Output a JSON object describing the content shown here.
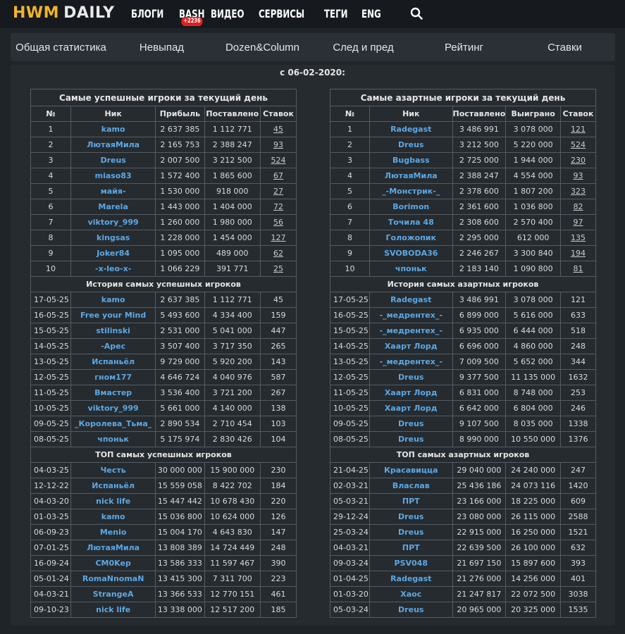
{
  "logo": {
    "part1": "HWM",
    "part2": "DAILY"
  },
  "nav": {
    "items": [
      "БЛОГИ",
      "BASH",
      "ВИДЕО",
      "СЕРВИСЫ",
      "ТЕГИ",
      "ENG"
    ],
    "bash_badge": "+2236"
  },
  "tabs": [
    "Общая статистика",
    "Невыпад",
    "Dozen&Column",
    "След и пред",
    "Рейтинг",
    "Ставки"
  ],
  "since": "с 06-02-2020:",
  "left": {
    "caption": "Самые успешные игроки за текущий день",
    "headers": [
      "№",
      "Ник",
      "Прибыль",
      "Поставлено",
      "Ставок"
    ],
    "daily": [
      [
        "1",
        "kamo",
        "2 637 385",
        "1 112 771",
        "45"
      ],
      [
        "2",
        "ЛютаяМила",
        "2 165 753",
        "2 388 247",
        "93"
      ],
      [
        "3",
        "Dreus",
        "2 007 500",
        "3 212 500",
        "524"
      ],
      [
        "4",
        "miaso83",
        "1 572 400",
        "1 865 600",
        "67"
      ],
      [
        "5",
        "майя-",
        "1 530 000",
        "918 000",
        "27"
      ],
      [
        "6",
        "Marela",
        "1 443 000",
        "1 404 000",
        "72"
      ],
      [
        "7",
        "viktory_999",
        "1 260 000",
        "1 980 000",
        "56"
      ],
      [
        "8",
        "kingsas",
        "1 228 000",
        "1 454 000",
        "127"
      ],
      [
        "9",
        "Joker84",
        "1 095 000",
        "489 000",
        "62"
      ],
      [
        "10",
        "-x-leo-x-",
        "1 066 229",
        "391 771",
        "25"
      ]
    ],
    "history_title": "История самых успешных игроков",
    "history": [
      [
        "17-05-25",
        "kamo",
        "2 637 385",
        "1 112 771",
        "45"
      ],
      [
        "16-05-25",
        "Free your Mind",
        "5 493 600",
        "4 334 400",
        "159"
      ],
      [
        "15-05-25",
        "stilinski",
        "2 531 000",
        "5 041 000",
        "447"
      ],
      [
        "14-05-25",
        "-Apec",
        "3 507 400",
        "3 717 350",
        "265"
      ],
      [
        "13-05-25",
        "Испаньёл",
        "9 729 000",
        "5 920 200",
        "143"
      ],
      [
        "12-05-25",
        "гном177",
        "4 646 724",
        "4 040 976",
        "587"
      ],
      [
        "11-05-25",
        "Вмастер",
        "3 536 400",
        "3 721 200",
        "267"
      ],
      [
        "10-05-25",
        "viktory_999",
        "5 661 000",
        "4 140 000",
        "138"
      ],
      [
        "09-05-25",
        "_Королева_Тьма_",
        "2 890 534",
        "2 710 454",
        "103"
      ],
      [
        "08-05-25",
        "чпоньк",
        "5 175 974",
        "2 830 426",
        "104"
      ]
    ],
    "top_title": "ТОП самых успешных игроков",
    "top": [
      [
        "04-03-25",
        "Честь",
        "30 000 000",
        "15 900 000",
        "230"
      ],
      [
        "12-12-22",
        "Испаньёл",
        "15 559 058",
        "8 422 702",
        "184"
      ],
      [
        "04-03-20",
        "nick life",
        "15 447 442",
        "10 678 430",
        "220"
      ],
      [
        "01-03-25",
        "kamo",
        "15 036 800",
        "10 624 000",
        "126"
      ],
      [
        "06-09-23",
        "Menio",
        "15 004 170",
        "4 643 830",
        "147"
      ],
      [
        "07-01-25",
        "ЛютаяМила",
        "13 808 389",
        "14 724 449",
        "248"
      ],
      [
        "16-09-24",
        "CM0Kep",
        "13 586 333",
        "11 597 467",
        "390"
      ],
      [
        "05-01-24",
        "RomaNnomaN",
        "13 415 300",
        "7 311 700",
        "223"
      ],
      [
        "04-03-21",
        "StrangeA",
        "13 366 533",
        "12 770 151",
        "461"
      ],
      [
        "09-10-23",
        "nick life",
        "13 338 000",
        "12 517 200",
        "185"
      ]
    ]
  },
  "right": {
    "caption": "Самые азартные игроки за текущий день",
    "headers": [
      "№",
      "Ник",
      "Поставлено",
      "Выиграно",
      "Ставок"
    ],
    "daily": [
      [
        "1",
        "Radegast",
        "3 486 991",
        "3 078 000",
        "121"
      ],
      [
        "2",
        "Dreus",
        "3 212 500",
        "5 220 000",
        "524"
      ],
      [
        "3",
        "Bugbass",
        "2 725 000",
        "1 944 000",
        "230"
      ],
      [
        "4",
        "ЛютаяМила",
        "2 388 247",
        "4 554 000",
        "93"
      ],
      [
        "5",
        "_-Монстрик-_",
        "2 378 600",
        "1 807 200",
        "323"
      ],
      [
        "6",
        "Borimon",
        "2 361 600",
        "1 036 800",
        "82"
      ],
      [
        "7",
        "Точила 48",
        "2 308 600",
        "2 570 400",
        "97"
      ],
      [
        "8",
        "Голожопик",
        "2 295 000",
        "612 000",
        "135"
      ],
      [
        "9",
        "SVOBODA36",
        "2 246 267",
        "3 300 840",
        "194"
      ],
      [
        "10",
        "чпоньк",
        "2 183 140",
        "1 090 800",
        "81"
      ]
    ],
    "history_title": "История самых азартных игроков",
    "history": [
      [
        "17-05-25",
        "Radegast",
        "3 486 991",
        "3 078 000",
        "121"
      ],
      [
        "16-05-25",
        "-_медрентех_-",
        "6 899 000",
        "5 616 000",
        "633"
      ],
      [
        "15-05-25",
        "-_медрентех_-",
        "6 935 000",
        "6 444 000",
        "518"
      ],
      [
        "14-05-25",
        "Хаарт Лорд",
        "6 696 000",
        "4 860 000",
        "248"
      ],
      [
        "13-05-25",
        "-_медрентех_-",
        "7 009 500",
        "5 652 000",
        "344"
      ],
      [
        "12-05-25",
        "Dreus",
        "9 377 500",
        "11 135 000",
        "1632"
      ],
      [
        "11-05-25",
        "Хаарт Лорд",
        "6 831 000",
        "8 748 000",
        "253"
      ],
      [
        "10-05-25",
        "Хаарт Лорд",
        "6 642 000",
        "6 804 000",
        "246"
      ],
      [
        "09-05-25",
        "Dreus",
        "9 107 500",
        "8 035 000",
        "1338"
      ],
      [
        "08-05-25",
        "Dreus",
        "8 990 000",
        "10 550 000",
        "1376"
      ]
    ],
    "top_title": "ТОП самых азартных игроков",
    "top": [
      [
        "21-04-25",
        "Красавицца",
        "29 040 000",
        "24 240 000",
        "247"
      ],
      [
        "02-03-21",
        "Власлав",
        "25 436 186",
        "24 073 116",
        "1420"
      ],
      [
        "05-03-21",
        "ПРТ",
        "23 166 000",
        "18 225 000",
        "609"
      ],
      [
        "29-12-24",
        "Dreus",
        "23 080 000",
        "26 115 000",
        "2588"
      ],
      [
        "25-03-24",
        "Dreus",
        "22 915 000",
        "16 250 000",
        "1521"
      ],
      [
        "04-03-21",
        "ПРТ",
        "22 639 500",
        "26 100 000",
        "632"
      ],
      [
        "09-03-24",
        "PSV048",
        "21 697 150",
        "15 897 600",
        "393"
      ],
      [
        "01-04-25",
        "Radegast",
        "21 276 000",
        "14 256 000",
        "401"
      ],
      [
        "01-03-20",
        "Хаос",
        "21 247 817",
        "22 072 500",
        "3038"
      ],
      [
        "05-03-24",
        "Dreus",
        "20 965 000",
        "20 325 000",
        "1535"
      ]
    ]
  }
}
